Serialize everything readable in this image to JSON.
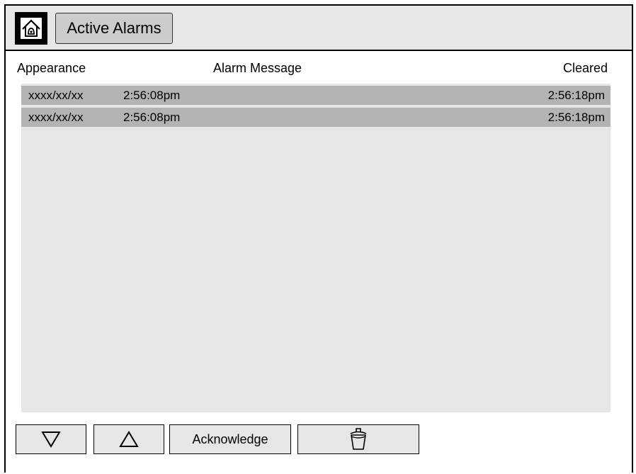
{
  "header": {
    "home_icon": "home-alarm-icon",
    "title": "Active Alarms"
  },
  "columns": {
    "appearance": "Appearance",
    "message": "Alarm Message",
    "cleared": "Cleared"
  },
  "alarms": [
    {
      "date": "xxxx/xx/xx",
      "time": "2:56:08pm",
      "message": "",
      "cleared": "2:56:18pm"
    },
    {
      "date": "xxxx/xx/xx",
      "time": "2:56:08pm",
      "message": "",
      "cleared": "2:56:18pm"
    }
  ],
  "toolbar": {
    "scroll_down_icon": "triangle-down-icon",
    "scroll_up_icon": "triangle-up-icon",
    "acknowledge_label": "Acknowledge",
    "delete_icon": "trash-icon"
  },
  "colors": {
    "header_bg": "#e6e6e6",
    "list_bg": "#e6e6e6",
    "row_bg": "#b3b3b3",
    "title_button_bg": "#cccccc"
  }
}
